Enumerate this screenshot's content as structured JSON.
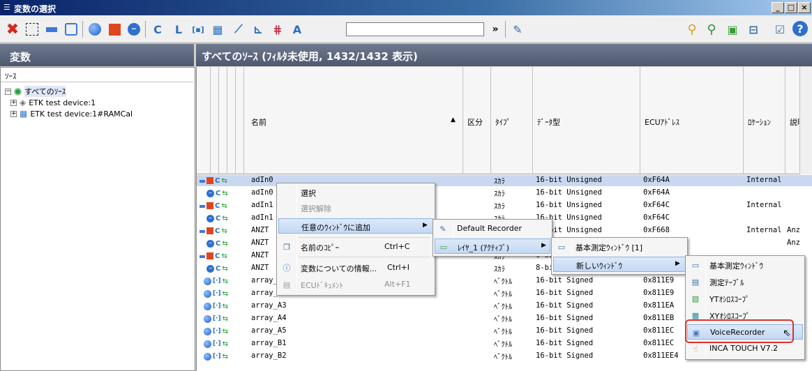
{
  "window": {
    "title": "変数の選択",
    "title_icon": "list-icon",
    "minimize": "_",
    "maximize": "□",
    "close": "×"
  },
  "toolbar": {
    "search_value": "",
    "overflow": "»",
    "icons": [
      "delete-icon",
      "select-rect-icon",
      "measure-icon",
      "calib-icon",
      "blue-dot-icon",
      "red-square-icon",
      "wave-icon",
      "c-filter-icon",
      "l-filter-icon",
      "array-icon",
      "matrix-icon",
      "curve-icon",
      "map-icon",
      "axis-icon",
      "ascii-icon",
      "edit-icon",
      "filter-icon",
      "filter-clear-icon",
      "image-icon",
      "layout-icon",
      "check-icon",
      "help-icon"
    ]
  },
  "left_panel": {
    "header": "変数",
    "tree_title": "ｿｰｽ",
    "items": [
      {
        "label": "すべてのｿｰｽ",
        "expander": "⊟",
        "icon": "green-node-icon",
        "selected": true
      },
      {
        "label": "ETK test device:1",
        "expander": "⊞",
        "icon": "device-icon",
        "selected": false
      },
      {
        "label": "ETK test device:1#RAMCal",
        "expander": "⊞",
        "icon": "table-icon",
        "selected": false
      }
    ]
  },
  "right_panel": {
    "header": "すべてのｿｰｽ (ﾌｨﾙﾀ未使用, 1432/1432 表示)",
    "columns": {
      "name": "名前",
      "sort_arrow": "▲",
      "kubun": "区分",
      "type": "ﾀｲﾌﾟ",
      "datatype": "ﾃﾞｰﾀ型",
      "ecu": "ECUｱﾄﾞﾚｽ",
      "location": "ﾛｹｰｼｮﾝ",
      "desc": "説明"
    },
    "rows": [
      {
        "kind": "meas",
        "name": "adIn0",
        "type": "ｽｶﾗ",
        "dtype": "16-bit Unsigned",
        "addr": "0xF64A",
        "loc": "Internal",
        "desc": ""
      },
      {
        "kind": "calib",
        "name": "adIn0",
        "type": "ｽｶﾗ",
        "dtype": "16-bit Unsigned",
        "addr": "0xF64A",
        "loc": "",
        "desc": ""
      },
      {
        "kind": "meas",
        "name": "adIn1",
        "type": "ｽｶﾗ",
        "dtype": "16-bit Unsigned",
        "addr": "0xF64C",
        "loc": "Internal",
        "desc": ""
      },
      {
        "kind": "calib",
        "name": "adIn1",
        "type": "ｽｶﾗ",
        "dtype": "16-bit Unsigned",
        "addr": "0xF64C",
        "loc": "",
        "desc": ""
      },
      {
        "kind": "meas",
        "name": "ANZT",
        "type": "ｽｶﾗ",
        "dtype": "16-bit Unsigned",
        "addr": "0xF668",
        "loc": "Internal",
        "desc": "Anz"
      },
      {
        "kind": "calib",
        "name": "ANZT",
        "type": "ｽｶﾗ",
        "dtype": "16-bit Unsigned",
        "addr": "",
        "loc": "",
        "desc": "Anz"
      },
      {
        "kind": "meas",
        "name": "ANZT",
        "type": "ｽｶﾗ",
        "dtype": "8-bit",
        "addr": "",
        "loc": "",
        "desc": ""
      },
      {
        "kind": "calib",
        "name": "ANZT",
        "type": "ｽｶﾗ",
        "dtype": "8-bit Unsigned",
        "addr": "",
        "loc": "",
        "desc": ""
      },
      {
        "kind": "array",
        "name": "array_A1",
        "type": "ﾍﾞｸﾄﾙ",
        "dtype": "16-bit Signed",
        "addr": "0x811E9",
        "loc": "",
        "desc": ""
      },
      {
        "kind": "array",
        "name": "array_A2",
        "type": "ﾍﾞｸﾄﾙ",
        "dtype": "16-bit Signed",
        "addr": "0x811E9",
        "loc": "",
        "desc": ""
      },
      {
        "kind": "array",
        "name": "array_A3",
        "type": "ﾍﾞｸﾄﾙ",
        "dtype": "16-bit Signed",
        "addr": "0x811EA",
        "loc": "",
        "desc": ""
      },
      {
        "kind": "array",
        "name": "array_A4",
        "type": "ﾍﾞｸﾄﾙ",
        "dtype": "16-bit Signed",
        "addr": "0x811EB",
        "loc": "",
        "desc": ""
      },
      {
        "kind": "array",
        "name": "array_A5",
        "type": "ﾍﾞｸﾄﾙ",
        "dtype": "16-bit Signed",
        "addr": "0x811EC",
        "loc": "",
        "desc": ""
      },
      {
        "kind": "array",
        "name": "array_B1",
        "type": "ﾍﾞｸﾄﾙ",
        "dtype": "16-bit Signed",
        "addr": "0x811EC",
        "loc": "",
        "desc": ""
      },
      {
        "kind": "array",
        "name": "array_B2",
        "type": "ﾍﾞｸﾄﾙ",
        "dtype": "16-bit Signed",
        "addr": "0x811EE4",
        "loc": "",
        "desc": ""
      }
    ]
  },
  "context_menu": {
    "select": "選択",
    "deselect": "選択解除",
    "add_to_window": "任意のｳｨﾝﾄﾞｳに追加",
    "copy_name": "名前のｺﾋﾟｰ",
    "copy_name_shortcut": "Ctrl+C",
    "info": "変数についての情報...",
    "info_shortcut": "Ctrl+I",
    "ecu_doc": "ECUﾄﾞｷｭﾒﾝﾄ",
    "ecu_doc_shortcut": "Alt+F1",
    "submenu_arrow": "▶"
  },
  "submenu1": {
    "recorder": "Default Recorder",
    "layer": "ﾚｲﾔ_1 (ｱｸﾃｨﾌﾞ)"
  },
  "submenu2": {
    "basic_window": "基本測定ｳｨﾝﾄﾞｳ [1]",
    "new_window": "新しいｳｨﾝﾄﾞｳ"
  },
  "submenu3": {
    "items": [
      {
        "label": "基本測定ｳｨﾝﾄﾞｳ",
        "icon": "window-icon"
      },
      {
        "label": "測定ﾃｰﾌﾞﾙ",
        "icon": "table-icon"
      },
      {
        "label": "YTｵｼﾛｽｺｰﾌﾟ",
        "icon": "yt-scope-icon"
      },
      {
        "label": "XYｵｼﾛｽｺｰﾌﾟ",
        "icon": "xy-scope-icon"
      },
      {
        "label": "VoiceRecorder",
        "icon": "voice-recorder-icon"
      },
      {
        "label": "INCA TOUCH V7.2",
        "icon": "touch-icon"
      }
    ]
  },
  "colors": {
    "title_bar": "#0a246a",
    "panel_header": "#5a6479",
    "highlight": "#c3d8f4",
    "callout": "#e0302a"
  }
}
